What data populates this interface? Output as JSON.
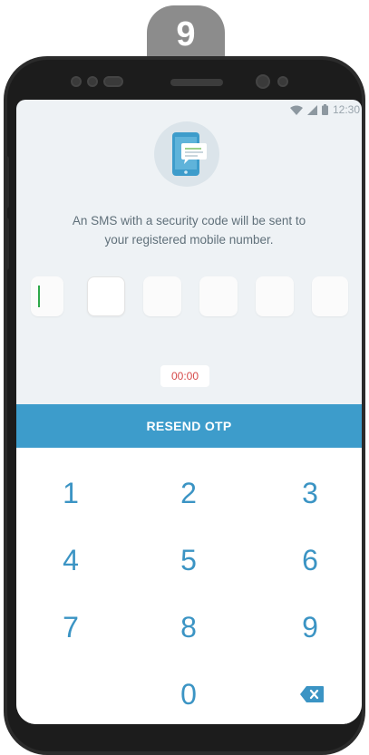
{
  "step": {
    "number": "9"
  },
  "status_bar": {
    "time": "12:30",
    "icons": [
      "wifi-icon",
      "cellular-icon",
      "battery-icon"
    ]
  },
  "illustration": {
    "icon": "sms-phone-icon"
  },
  "message": {
    "line1": "An SMS with a security code will be sent to",
    "line2": "your registered mobile number."
  },
  "otp": {
    "length": 6,
    "values": [
      "",
      "",
      "",
      "",
      "",
      ""
    ]
  },
  "timer": {
    "value": "00:00"
  },
  "resend": {
    "label": "RESEND OTP"
  },
  "keypad": {
    "keys": [
      "1",
      "2",
      "3",
      "4",
      "5",
      "6",
      "7",
      "8",
      "9",
      "0"
    ],
    "backspace_icon": "backspace-icon"
  },
  "colors": {
    "accent": "#3d9ccb",
    "key_text": "#3b94c4",
    "timer_text": "#d64a4a",
    "cursor": "#2ea84a",
    "screen_bg": "#eef2f5",
    "bezel": "#2b2b2b"
  }
}
